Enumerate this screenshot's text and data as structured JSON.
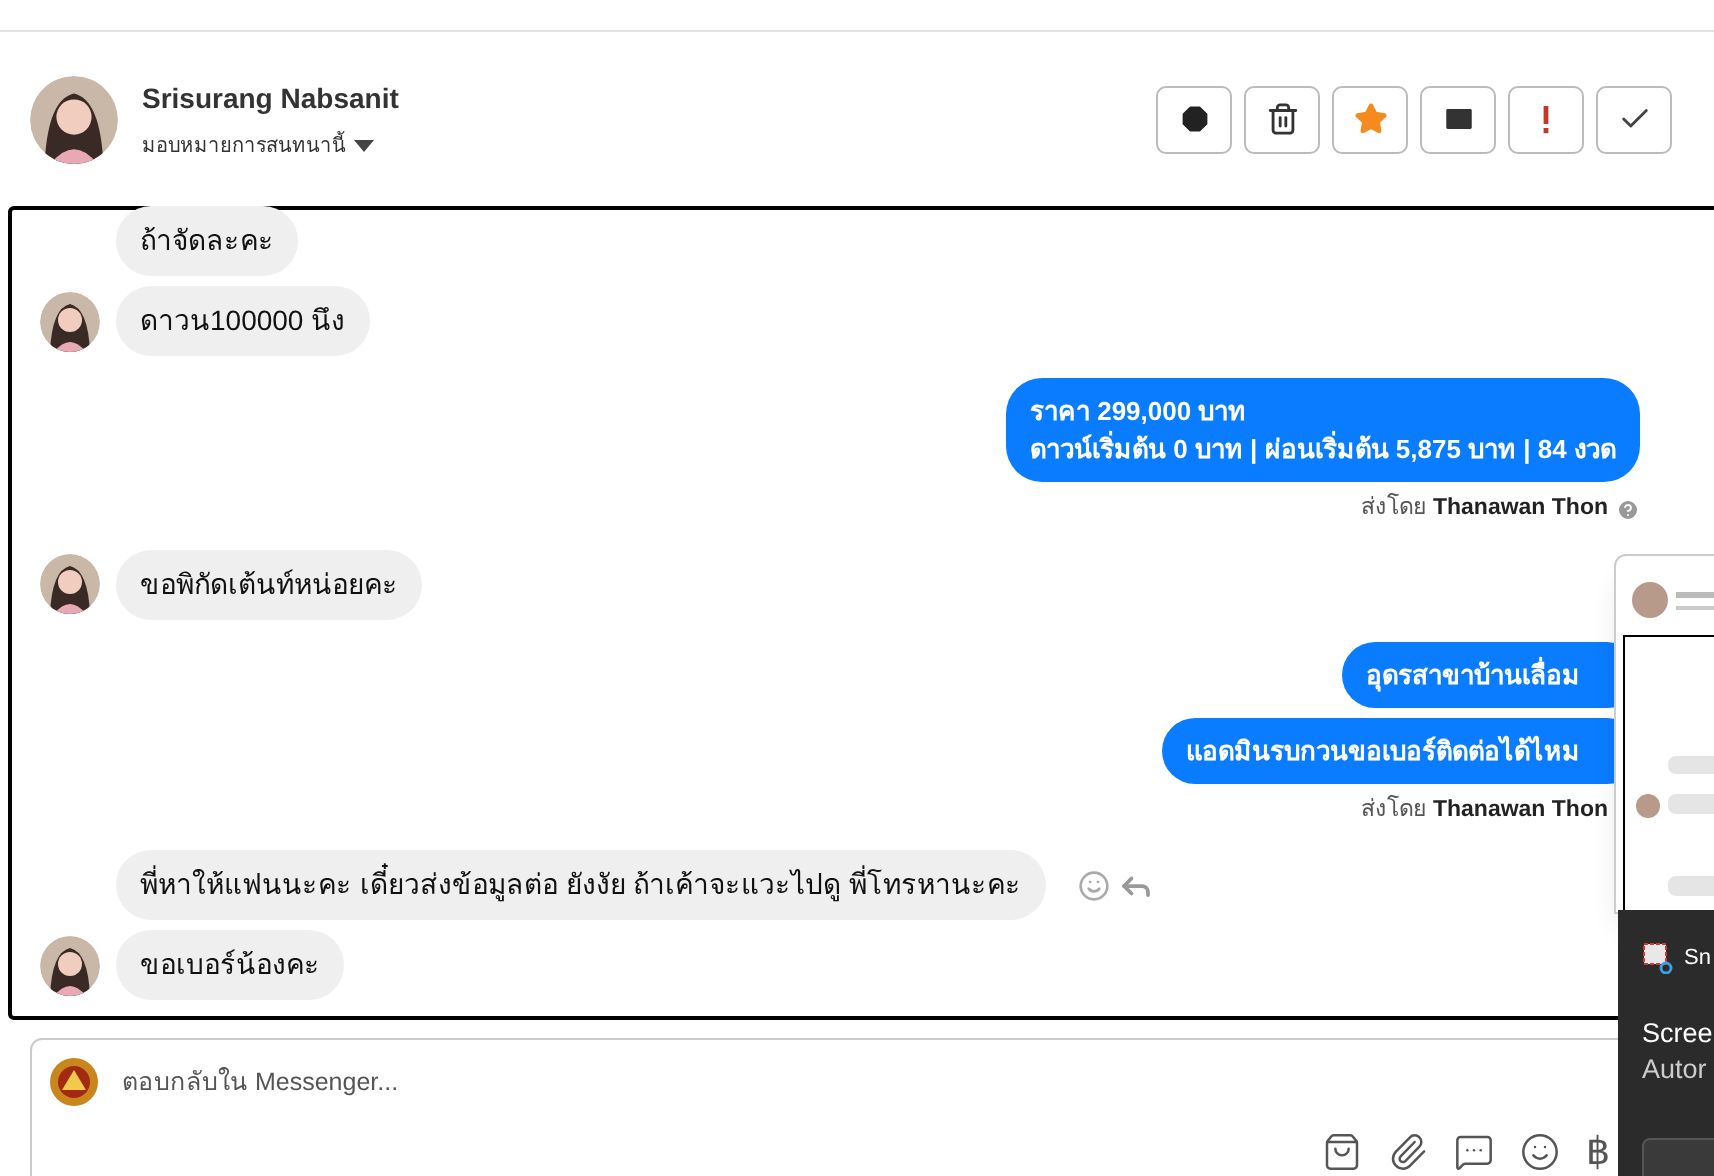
{
  "contact": {
    "name": "Srisurang Nabsanit",
    "assign_label": "มอบหมายการสนทนานี้"
  },
  "toolbar": [
    {
      "kind": "spam"
    },
    {
      "kind": "delete"
    },
    {
      "kind": "star"
    },
    {
      "kind": "unread"
    },
    {
      "kind": "important"
    },
    {
      "kind": "done"
    }
  ],
  "messages": [
    {
      "kind": "incoming",
      "text": "ถ้าจัดละคะ",
      "avatar": false
    },
    {
      "kind": "incoming",
      "text": "ดาวน100000 นึง",
      "avatar": true
    },
    {
      "kind": "outgoing",
      "lines": [
        "ราคา 299,000 บาท",
        "ดาวน์เริ่มต้น 0 บาท | ผ่อนเริ่มต้น 5,875 บาท | 84 งวด"
      ]
    },
    {
      "kind": "sender",
      "prefix": "ส่งโดย",
      "name": "Thanawan Thon",
      "help": true
    },
    {
      "kind": "incoming",
      "text": "ขอพิกัดเต้นท์หน่อยคะ",
      "avatar": true
    },
    {
      "kind": "outgoing",
      "lines": [
        "อุดรสาขาบ้านเลื่อม"
      ]
    },
    {
      "kind": "outgoing",
      "lines": [
        "แอดมินรบกวนขอเบอร์ติดต่อได้ไหม"
      ]
    },
    {
      "kind": "sender",
      "prefix": "ส่งโดย",
      "name": "Thanawan Thon",
      "help": false
    },
    {
      "kind": "incoming",
      "text": "พี่หาให้แฟนนะคะ เดี๋ยวส่งข้อมูลต่อ ยังงัย ถ้าเค้าจะแวะไปดู พี่โทรหานะคะ",
      "avatar": false,
      "actions": true
    },
    {
      "kind": "incoming",
      "text": "ขอเบอร์น้องคะ",
      "avatar": true
    }
  ],
  "composer": {
    "placeholder": "ตอบกลับใน Messenger...",
    "tools": [
      {
        "kind": "bag"
      },
      {
        "kind": "attach"
      },
      {
        "kind": "chat"
      },
      {
        "kind": "emoji"
      },
      {
        "kind": "currency",
        "symbol": "฿"
      }
    ]
  },
  "toast": {
    "app": "Sn",
    "title": "Scree",
    "body": "Autor"
  }
}
